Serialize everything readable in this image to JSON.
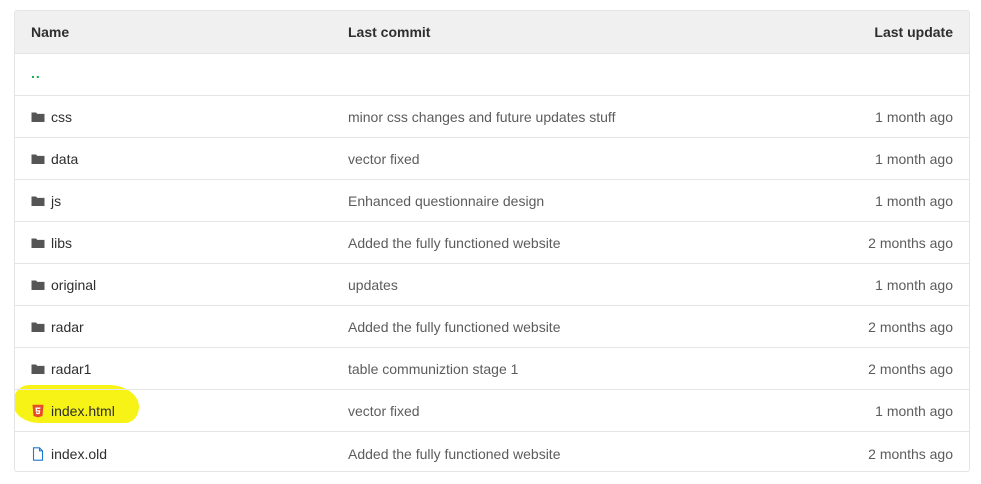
{
  "table": {
    "headers": {
      "name": "Name",
      "last_commit": "Last commit",
      "last_update": "Last update"
    },
    "parent_link": "..",
    "rows": [
      {
        "name": "css",
        "type": "folder",
        "commit": "minor css changes and future updates stuff",
        "updated": "1 month ago"
      },
      {
        "name": "data",
        "type": "folder",
        "commit": "vector fixed",
        "updated": "1 month ago"
      },
      {
        "name": "js",
        "type": "folder",
        "commit": "Enhanced questionnaire design",
        "updated": "1 month ago"
      },
      {
        "name": "libs",
        "type": "folder",
        "commit": "Added the fully functioned website",
        "updated": "2 months ago"
      },
      {
        "name": "original",
        "type": "folder",
        "commit": "updates",
        "updated": "1 month ago"
      },
      {
        "name": "radar",
        "type": "folder",
        "commit": "Added the fully functioned website",
        "updated": "2 months ago"
      },
      {
        "name": "radar1",
        "type": "folder",
        "commit": "table communiztion stage 1",
        "updated": "2 months ago"
      },
      {
        "name": "index.html",
        "type": "html5-file",
        "commit": "vector fixed",
        "updated": "1 month ago"
      },
      {
        "name": "index.old",
        "type": "file",
        "commit": "Added the fully functioned website",
        "updated": "2 months ago"
      }
    ]
  },
  "colors": {
    "parent_link": "#1aaa55",
    "highlight": "#f8f20a",
    "html5_icon": "#e44d26",
    "file_icon": "#1f78d1",
    "folder_icon": "#555555"
  },
  "icons": {
    "folder": "folder-icon",
    "html5-file": "html5-icon",
    "file": "file-icon"
  }
}
